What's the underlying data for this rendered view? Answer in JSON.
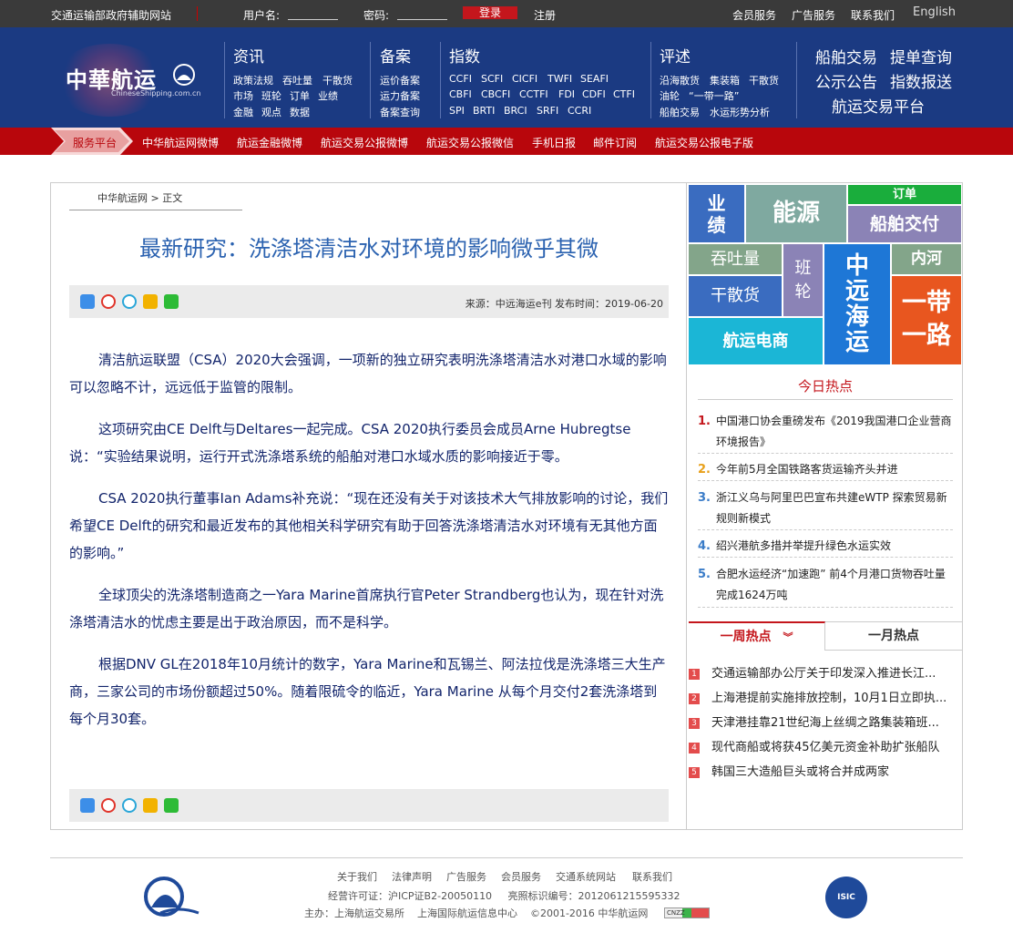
{
  "topbar": {
    "site_note": "交通运输部政府辅助网站",
    "username_label": "用户名:",
    "password_label": "密码:",
    "login": "登录",
    "register": "注册",
    "links": [
      "会员服务",
      "广告服务",
      "联系我们",
      "English"
    ]
  },
  "header": {
    "logo_cn": "中華航运",
    "logo_en": "ChineseShipping.com.cn",
    "sections": [
      {
        "title": "资讯",
        "rows": [
          [
            "政策法规",
            "吞吐量",
            "干散货"
          ],
          [
            "市场",
            "班轮",
            "订单",
            "业绩"
          ],
          [
            "金融",
            "观点",
            "数据"
          ]
        ]
      },
      {
        "title": "备案",
        "rows": [
          [
            "运价备案"
          ],
          [
            "运力备案"
          ],
          [
            "备案查询"
          ]
        ]
      },
      {
        "title": "指数",
        "rows": [
          [
            "CCFI",
            "SCFI",
            "CICFI",
            "TWFI",
            "SEAFI"
          ],
          [
            "CBFI",
            "CBCFI",
            "CCTFI",
            "FDI",
            "CDFI",
            "CTFI"
          ],
          [
            "SPI",
            "BRTI",
            "BRCI",
            "SRFI",
            "CCRI"
          ]
        ]
      },
      {
        "title": "评述",
        "rows": [
          [
            "沿海散货",
            "集装箱",
            "干散货"
          ],
          [
            "油轮",
            "“一带一路”"
          ],
          [
            "船舶交易",
            "水运形势分析"
          ]
        ]
      }
    ],
    "big_links": [
      "船舶交易",
      "提单查询",
      "公示公告",
      "指数报送",
      "航运交易平台"
    ]
  },
  "rednav": {
    "platform": "服务平台",
    "items": [
      "中华航运网微博",
      "航运金融微博",
      "航运交易公报微博",
      "航运交易公报微信",
      "手机日报",
      "邮件订阅",
      "航运交易公报电子版"
    ]
  },
  "article": {
    "breadcrumb": "中华航运网 > 正文",
    "title": "最新研究：洗涤塔清洁水对环境的影响微乎其微",
    "meta": "来源：中远海运e刊    发布时间：2019-06-20",
    "paragraphs": [
      "清洁航运联盟（CSA）2020大会强调，一项新的独立研究表明洗涤塔清洁水对港口水域的影响可以忽略不计，远远低于监管的限制。",
      "这项研究由CE Delft与Deltares一起完成。CSA 2020执行委员会成员Arne Hubregtse说：“实验结果说明，运行开式洗涤塔系统的船舶对港口水域水质的影响接近于零。",
      "CSA 2020执行董事Ian Adams补充说：“现在还没有关于对该技术大气排放影响的讨论，我们希望CE Delft的研究和最近发布的其他相关科学研究有助于回答洗涤塔清洁水对环境有无其他方面的影响。”",
      "全球顶尖的洗涤塔制造商之一Yara Marine首席执行官Peter Strandberg也认为，现在针对洗涤塔清洁水的忧虑主要是出于政治原因，而不是科学。",
      "根据DNV GL在2018年10月统计的数字，Yara Marine和瓦锡兰、阿法拉伐是洗涤塔三大生产商，三家公司的市场份额超过50%。随着限硫令的临近，Yara Marine 从每个月交付2套洗涤塔到每个月30套。"
    ]
  },
  "tiles": {
    "yeji": "业\n绩",
    "nengyuan": "能源",
    "dingdan": "订单",
    "chuanbo": "船舶交付",
    "tutu": "吞吐量",
    "banlun": "班\n轮",
    "cosco": "中\n远\n海\n运",
    "nehe": "内河",
    "gansan": "干散货",
    "ydyl": "一带\n一路",
    "dianshang": "航运电商",
    "colors": {
      "blue": "#3a6cc0",
      "teal": "#7fa9a0",
      "green": "#1aad3c",
      "purple": "#8b83b6",
      "blue2": "#1e77d6",
      "orange": "#e8561f",
      "olive": "#83a58a",
      "cyan": "#1bb6d6"
    }
  },
  "hot": {
    "title": "今日热点",
    "items": [
      {
        "num": "1.",
        "text": "中国港口协会重磅发布《2019我国港口企业营商环境报告》"
      },
      {
        "num": "2.",
        "text": "今年前5月全国铁路客货运输齐头并进"
      },
      {
        "num": "3.",
        "text": "浙江义乌与阿里巴巴宣布共建eWTP 探索贸易新规则新模式"
      },
      {
        "num": "4.",
        "text": "绍兴港航多措并举提升绿色水运实效"
      },
      {
        "num": "5.",
        "text": "合肥水运经济“加速跑” 前4个月港口货物吞吐量完成1624万吨"
      }
    ],
    "num_colors": [
      "#c4161c",
      "#e8a01a",
      "#3a7cc8",
      "#3a7cc8",
      "#3a7cc8"
    ]
  },
  "weekly": {
    "tab_week": "一周热点",
    "tab_month": "一月热点",
    "items": [
      {
        "num": "1",
        "text": "交通运输部办公厅关于印发深入推进长江..."
      },
      {
        "num": "2",
        "text": "上海港提前实施排放控制，10月1日立即执..."
      },
      {
        "num": "3",
        "text": "天津港挂靠21世纪海上丝绸之路集装箱班..."
      },
      {
        "num": "4",
        "text": "现代商船或将获45亿美元资金补助扩张船队"
      },
      {
        "num": "5",
        "text": "韩国三大造船巨头或将合并成两家"
      }
    ]
  },
  "footer": {
    "links": [
      "关于我们",
      "法律声明",
      "广告服务",
      "会员服务",
      "交通系统网站",
      "联系我们"
    ],
    "license": "经营许可证：沪ICP证B2-20050110     亮照标识编号：2012061215595332",
    "sponsor": "主办：上海航运交易所    上海国际航运信息中心    ©2001-2016 中华航运网",
    "cnzz": "CNZZ",
    "isic": "ISIC"
  }
}
